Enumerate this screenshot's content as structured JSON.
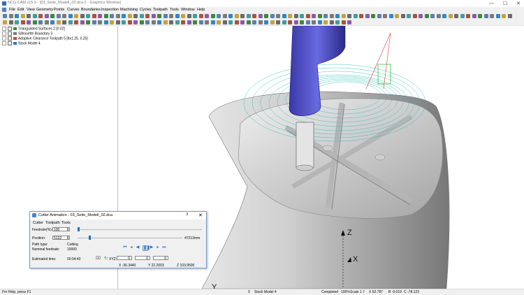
{
  "window": {
    "title": "NCG CAM v15.0 - [03_Seite_Modell_02.dca:2 - Graphics Window]",
    "minimize": "—",
    "maximize": "☐",
    "close": "✕"
  },
  "menubar": [
    "File",
    "Edit",
    "View",
    "Geometry",
    "Points",
    "Curves",
    "Boundaries",
    "Inspection",
    "Machining",
    "Cycles",
    "Toolpath",
    "Tools",
    "Window",
    "Help"
  ],
  "tree": {
    "items": [
      {
        "label": "Triangulated Surfaces 2 [0.02]",
        "checked": true,
        "icon_color": "#3a8a3a"
      },
      {
        "label": "Silhouette Boundary 3",
        "checked": false,
        "icon_color": "#7a7a7a"
      },
      {
        "label": "Adaptive Clearance Toolpath 5 [8x1.25, 0.25]",
        "checked": true,
        "icon_color": "#c84a2a"
      },
      {
        "label": "Stock Model 4",
        "checked": false,
        "icon_color": "#2a7ac8"
      }
    ]
  },
  "viewport": {
    "axis_z": "Z",
    "axis_x": "X",
    "axis_y": "Y",
    "coords": {
      "x": "X -36.3440",
      "y": "Y 22.2003",
      "z": "Z 103.9500"
    }
  },
  "dialog": {
    "title": "Cutter Animation - 03_Seite_Modell_02.dca",
    "help": "?",
    "close": "✕",
    "menu": [
      "Cutter",
      "Toolpath",
      "Tools"
    ],
    "feedrate_label": "Feedrate(%):",
    "feedrate_value": "100",
    "position_label": "Position:",
    "position_value": "5132",
    "position_max": "47213mm",
    "feedrate_slider": 0.0,
    "position_slider": 0.108,
    "path_type_label": "Path type:",
    "path_type_value": "Cutting",
    "nominal_feed_label": "Nominal feedrate:",
    "nominal_feed_value": "10000",
    "estimated_label": "Estimated time:",
    "estimated_value": "00:04:43",
    "xyz_label": "XYZ:",
    "xyz_values": [
      "0",
      "0",
      "0"
    ]
  },
  "status": {
    "help": "For Help, press F1",
    "zero": "0",
    "stock": "Stock Model 4",
    "completed": "Completed",
    "percent": "100%",
    "scale": "Scale 1.7",
    "x": "X 52.787",
    "y": "B -9.019",
    "z": "C -78.123"
  }
}
